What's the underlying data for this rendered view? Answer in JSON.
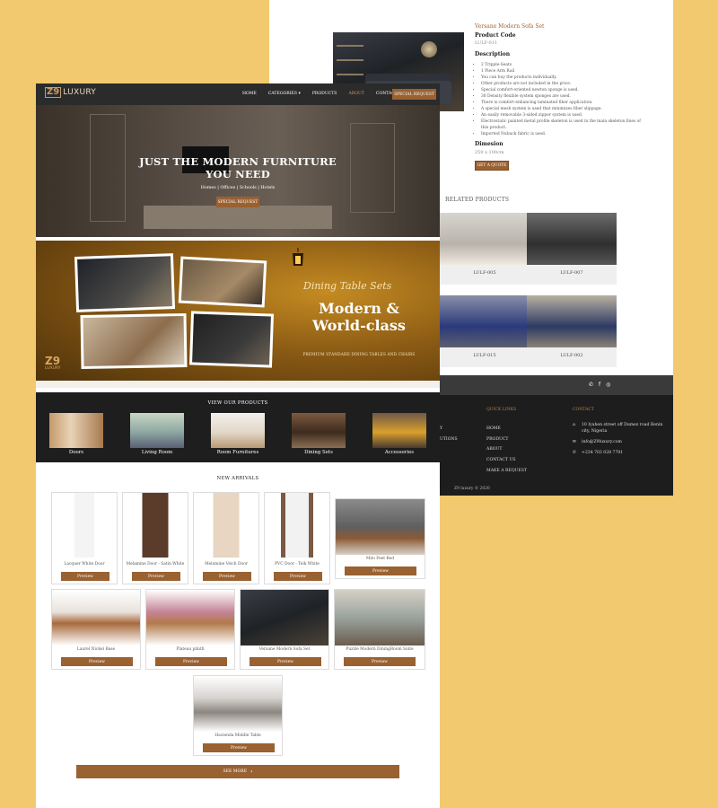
{
  "detail": {
    "title": "Versane Modern Sofa Set",
    "product_code_label": "Product Code",
    "product_code": "LULF-011",
    "description_label": "Description",
    "description_items": [
      "2 Tripple-Seats",
      "1 Piece Arm Rail",
      "You can buy the products individually.",
      "Other products are not included in the price.",
      "Special comfort-oriented newton sponge is used.",
      "30 Density flexible system sponges are used.",
      "There is comfort-enhancing laminated fiber application.",
      "A special mesh system is used that minimizes fiber slippage.",
      "An easily removable 3-sided zipper system is used.",
      "Electrostatic painted metal profile skeleton is used in the main skeleton lines of this product.",
      "Imported Nubuck fabric is used."
    ],
    "dimension_label": "Dimesion",
    "dimension": "250 x 100cm",
    "quote_button": "GET A QUOTE",
    "related_title": "RELATED PRODUCTS",
    "related": [
      {
        "code": "LULF-005"
      },
      {
        "code": "LULF-007"
      },
      {
        "code": "LULF-015"
      },
      {
        "code": "LULF-002"
      }
    ]
  },
  "back_footer": {
    "social": [
      "whatsapp-icon",
      "facebook-icon",
      "instagram-icon"
    ],
    "cut_links": [
      "Y",
      "",
      "UTIONS"
    ],
    "quick_links_title": "QUICK LINKS",
    "quick_links": [
      "HOME",
      "PRODUCT",
      "ABOUT",
      "CONTACT US",
      "MAKE A REQUEST"
    ],
    "contact_title": "CONTACT",
    "address": "10 Iyahen street off Dumez road Benin city, Nigeria",
    "email": "info@Z9luxury.com",
    "phone": "+234 703 028 7701",
    "copyright": "Z9 luxury © 2020"
  },
  "nav": {
    "logo_mark": "Z9",
    "logo_word": "LUXURY",
    "links": [
      "HOME",
      "CATEGORIES ▾",
      "PRODUCTS",
      "ABOUT",
      "CONTACT"
    ],
    "active_index": 3,
    "cta": "SPECIAL REQUEST"
  },
  "hero": {
    "title_line1": "JUST THE MODERN FURNITURE",
    "title_line2": "YOU NEED",
    "subtitle": "Homes | Offices | Schools | Hotels",
    "button": "SPECIAL REQUEST"
  },
  "banner": {
    "script": "Dining Table Sets",
    "headline_line1": "Modern &",
    "headline_line2": "World-class",
    "sub": "PREMIUM STANDARD DINING TABLES AND CHAIRS",
    "logo_mark": "Z9",
    "logo_word": "LUXURY"
  },
  "products": {
    "title": "VIEW OUR PRODUCTS",
    "categories": [
      "Doors",
      "Living Room",
      "Room Furnitures",
      "Dining Sets",
      "Accessories"
    ]
  },
  "arrivals": {
    "title": "NEW ARRIVALS",
    "items": [
      "Lacquer White Door",
      "Melamine Door - Satin White",
      "Melamine Veich Door",
      "PVC Door - Teik White",
      "Milo Feet Bed",
      "Laurel Nickel Base",
      "Plateau plinth",
      "Versane Modern Sofa Set",
      "Puzzle Modern DiningRoom Suite",
      "Hacienda Middle Table"
    ],
    "preview_label": "Preview",
    "see_more": "SEE MORE"
  },
  "colors": {
    "accent": "#9a6131",
    "background": "#f2c96f",
    "dark": "#1e1e1e"
  }
}
